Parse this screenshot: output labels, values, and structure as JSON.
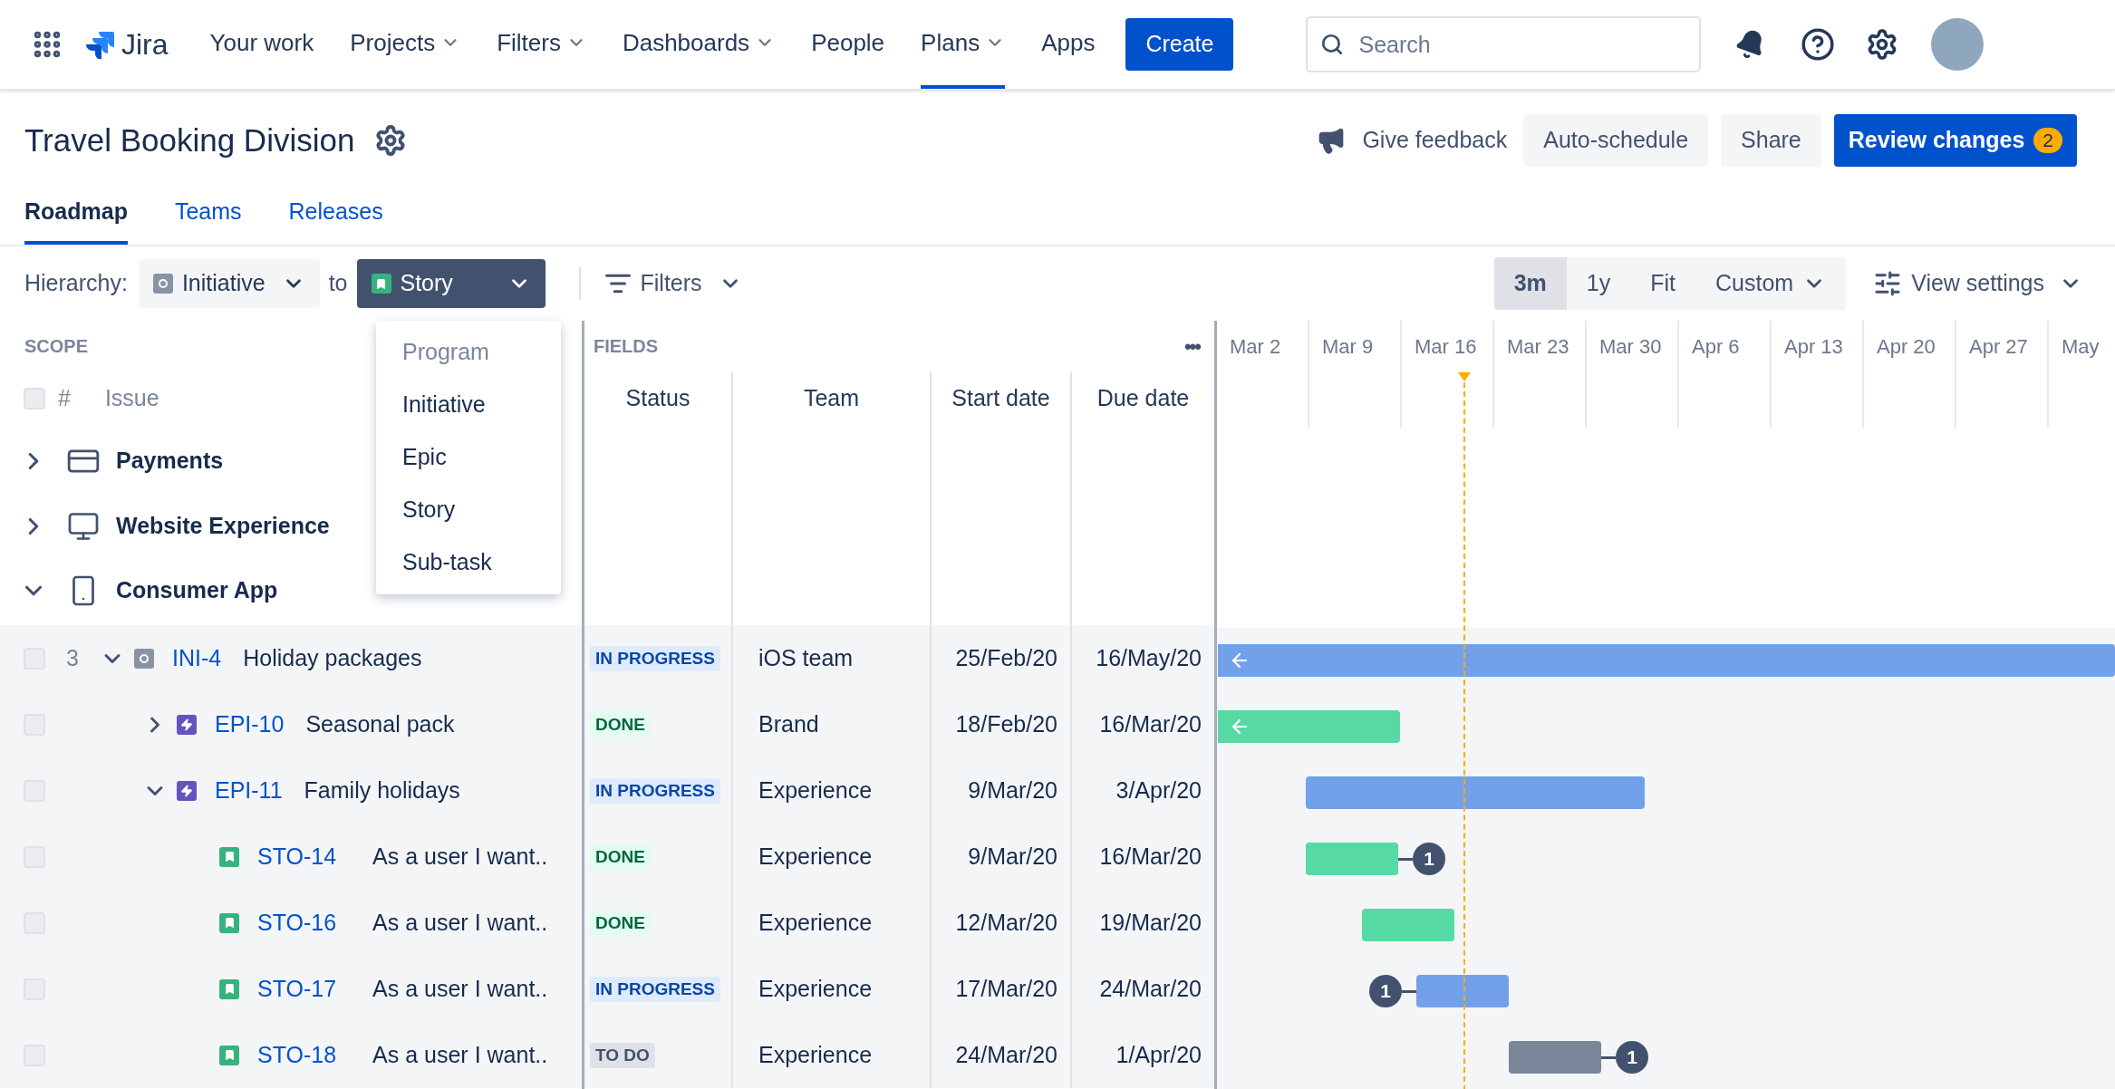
{
  "nav": {
    "product": "Jira",
    "items": [
      {
        "label": "Your work",
        "dropdown": false,
        "selected": false
      },
      {
        "label": "Projects",
        "dropdown": true,
        "selected": false
      },
      {
        "label": "Filters",
        "dropdown": true,
        "selected": false
      },
      {
        "label": "Dashboards",
        "dropdown": true,
        "selected": false
      },
      {
        "label": "People",
        "dropdown": false,
        "selected": false
      },
      {
        "label": "Plans",
        "dropdown": true,
        "selected": true
      },
      {
        "label": "Apps",
        "dropdown": false,
        "selected": false
      }
    ],
    "create": "Create",
    "search": {
      "placeholder": "Search"
    }
  },
  "header": {
    "title": "Travel Booking Division",
    "feedback": "Give feedback",
    "auto_schedule": "Auto-schedule",
    "share": "Share",
    "review": {
      "label": "Review changes",
      "count": "2"
    }
  },
  "tabs": [
    {
      "label": "Roadmap",
      "selected": true
    },
    {
      "label": "Teams",
      "selected": false
    },
    {
      "label": "Releases",
      "selected": false
    }
  ],
  "toolbar": {
    "hierarchy_label": "Hierarchy:",
    "from": "Initiative",
    "to_label": "to",
    "to": "Story",
    "filters": "Filters",
    "ranges": [
      {
        "label": "3m",
        "selected": true,
        "dropdown": false
      },
      {
        "label": "1y",
        "selected": false,
        "dropdown": false
      },
      {
        "label": "Fit",
        "selected": false,
        "dropdown": false
      },
      {
        "label": "Custom",
        "selected": false,
        "dropdown": true
      }
    ],
    "view_settings": "View settings"
  },
  "hierarchy_menu": [
    {
      "label": "Program",
      "disabled": true
    },
    {
      "label": "Initiative",
      "disabled": false
    },
    {
      "label": "Epic",
      "disabled": false
    },
    {
      "label": "Story",
      "disabled": false
    },
    {
      "label": "Sub-task",
      "disabled": false
    }
  ],
  "scope": {
    "title": "SCOPE",
    "header_checked": false,
    "columns": [
      "#",
      "Issue"
    ]
  },
  "fields": {
    "title": "FIELDS",
    "more": "•••",
    "columns": [
      "Status",
      "Team",
      "Start date",
      "Due date"
    ]
  },
  "timeline": {
    "weeks": [
      "Mar 2",
      "Mar 9",
      "Mar 16",
      "Mar 23",
      "Mar 30",
      "Apr 6",
      "Apr 13",
      "Apr 20",
      "Apr 27",
      "May"
    ]
  },
  "groups": [
    {
      "label": "Payments",
      "expanded": false
    },
    {
      "label": "Website Experience",
      "expanded": false
    },
    {
      "label": "Consumer App",
      "expanded": true,
      "children": [
        {
          "kind": "initiative",
          "count": "3",
          "key": "INI-4",
          "summary": "Holiday packages",
          "status": {
            "text": "IN PROGRESS",
            "kind": "inprogress"
          },
          "team": "iOS team",
          "start": "25/Feb/20",
          "due": "16/May/20",
          "checked": false,
          "expanded": true,
          "bar": {
            "offscreen_start": true
          },
          "children": [
            {
              "kind": "epic",
              "key": "EPI-10",
              "summary": "Seasonal pack",
              "status": {
                "text": "DONE",
                "kind": "done"
              },
              "team": "Brand",
              "start": "18/Feb/20",
              "due": "16/Mar/20",
              "checked": false,
              "expanded": false,
              "bar": {
                "offscreen_start": true
              }
            },
            {
              "kind": "epic",
              "key": "EPI-11",
              "summary": "Family holidays",
              "status": {
                "text": "IN PROGRESS",
                "kind": "inprogress"
              },
              "team": "Experience",
              "start": "9/Mar/20",
              "due": "3/Apr/20",
              "checked": false,
              "expanded": true,
              "bar": {
                "offscreen_start": false
              },
              "children": [
                {
                  "kind": "story",
                  "key": "STO-14",
                  "summary": "As a user I want..",
                  "status": {
                    "text": "DONE",
                    "kind": "done"
                  },
                  "team": "Experience",
                  "start": "9/Mar/20",
                  "due": "16/Mar/20",
                  "checked": false,
                  "bar": {
                    "offscreen_start": false,
                    "badge_after": "1"
                  }
                },
                {
                  "kind": "story",
                  "key": "STO-16",
                  "summary": "As a user I want..",
                  "status": {
                    "text": "DONE",
                    "kind": "done"
                  },
                  "team": "Experience",
                  "start": "12/Mar/20",
                  "due": "19/Mar/20",
                  "checked": false,
                  "bar": {
                    "offscreen_start": false
                  }
                },
                {
                  "kind": "story",
                  "key": "STO-17",
                  "summary": "As a user I want..",
                  "status": {
                    "text": "IN PROGRESS",
                    "kind": "inprogress"
                  },
                  "team": "Experience",
                  "start": "17/Mar/20",
                  "due": "24/Mar/20",
                  "checked": false,
                  "bar": {
                    "offscreen_start": false,
                    "badge_before": "1"
                  }
                },
                {
                  "kind": "story",
                  "key": "STO-18",
                  "summary": "As a user I want..",
                  "status": {
                    "text": "TO DO",
                    "kind": "todo"
                  },
                  "team": "Experience",
                  "start": "24/Mar/20",
                  "due": "1/Apr/20",
                  "checked": false,
                  "bar": {
                    "offscreen_start": false,
                    "badge_after": "1"
                  }
                }
              ]
            }
          ]
        }
      ]
    }
  ]
}
